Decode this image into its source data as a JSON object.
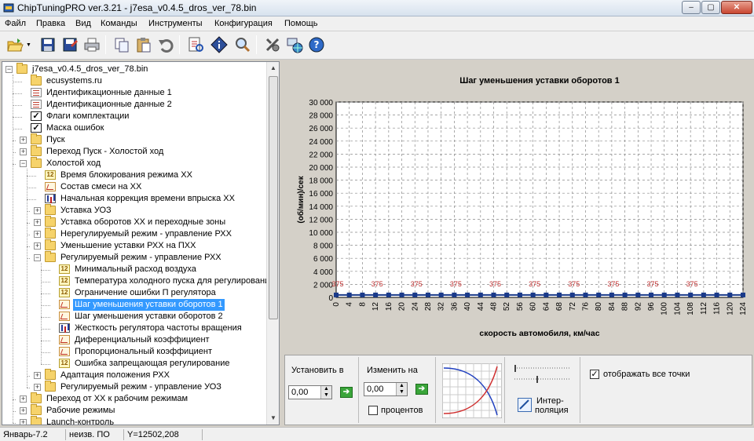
{
  "window": {
    "title": "ChipTuningPRO ver.3.21 - j7esa_v0.4.5_dros_ver_78.bin",
    "min_glyph": "–",
    "max_glyph": "▢",
    "close_glyph": "✕"
  },
  "menu": [
    "Файл",
    "Правка",
    "Вид",
    "Команды",
    "Инструменты",
    "Конфигурация",
    "Помощь"
  ],
  "toolbar_icons": [
    "open-icon",
    "save-icon",
    "save-as-icon",
    "print-icon",
    "copy-icon",
    "paste-icon",
    "undo-icon",
    "compare-icon",
    "info-icon",
    "search-icon",
    "settings-icon",
    "network-icon",
    "help-icon"
  ],
  "tree": [
    {
      "label": "j7esa_v0.4.5_dros_ver_78.bin",
      "icon": "folder-icon",
      "level": 0,
      "expander": "-"
    },
    {
      "label": "ecusystems.ru",
      "icon": "folder-icon",
      "level": 1,
      "expander": ""
    },
    {
      "label": "Идентификационные данные 1",
      "icon": "document-icon",
      "level": 1,
      "expander": ""
    },
    {
      "label": "Идентификационные данные 2",
      "icon": "document-icon",
      "level": 1,
      "expander": ""
    },
    {
      "label": "Флаги комплектации",
      "icon": "checkbox-icon",
      "level": 1,
      "expander": ""
    },
    {
      "label": "Маска ошибок",
      "icon": "checkbox-icon",
      "level": 1,
      "expander": ""
    },
    {
      "label": "Пуск",
      "icon": "folder-icon",
      "level": 1,
      "expander": "+"
    },
    {
      "label": "Переход Пуск - Холостой ход",
      "icon": "folder-icon",
      "level": 1,
      "expander": "+"
    },
    {
      "label": "Холостой ход",
      "icon": "folder-icon",
      "level": 1,
      "expander": "-"
    },
    {
      "label": "Время блокирования режима ХХ",
      "icon": "constant-icon",
      "level": 2,
      "expander": ""
    },
    {
      "label": "Состав смеси на ХХ",
      "icon": "graph-icon",
      "level": 2,
      "expander": ""
    },
    {
      "label": "Начальная коррекция времени впрыска ХХ",
      "icon": "bar-chart-icon",
      "level": 2,
      "expander": ""
    },
    {
      "label": "Уставка УОЗ",
      "icon": "folder-icon",
      "level": 2,
      "expander": "+"
    },
    {
      "label": "Уставка оборотов ХХ и переходные зоны",
      "icon": "folder-icon",
      "level": 2,
      "expander": "+"
    },
    {
      "label": "Нерегулируемый режим - управление РХХ",
      "icon": "folder-icon",
      "level": 2,
      "expander": "+"
    },
    {
      "label": "Уменьшение уставки РХХ на ПХХ",
      "icon": "folder-icon",
      "level": 2,
      "expander": "+"
    },
    {
      "label": "Регулируемый режим - управление РХХ",
      "icon": "folder-icon",
      "level": 2,
      "expander": "-"
    },
    {
      "label": "Минимальный расход воздуха",
      "icon": "constant-icon",
      "level": 3,
      "expander": ""
    },
    {
      "label": "Температура холодного пуска для регулирования",
      "icon": "constant-icon",
      "level": 3,
      "expander": ""
    },
    {
      "label": "Ограничение ошибки П регулятора",
      "icon": "constant-icon",
      "level": 3,
      "expander": ""
    },
    {
      "label": "Шаг уменьшения уставки оборотов 1",
      "icon": "graph-icon",
      "level": 3,
      "expander": "",
      "selected": true
    },
    {
      "label": "Шаг уменьшения уставки оборотов 2",
      "icon": "graph-icon",
      "level": 3,
      "expander": ""
    },
    {
      "label": "Жесткость регулятора частоты вращения",
      "icon": "bar-chart-icon",
      "level": 3,
      "expander": ""
    },
    {
      "label": "Диференциальный коэффициент",
      "icon": "graph-icon",
      "level": 3,
      "expander": ""
    },
    {
      "label": "Пропорциональный коэффициент",
      "icon": "graph-icon",
      "level": 3,
      "expander": ""
    },
    {
      "label": "Ошибка запрещающая регулирование",
      "icon": "constant-icon",
      "level": 3,
      "expander": ""
    },
    {
      "label": "Адаптация положения  РХХ",
      "icon": "folder-icon",
      "level": 2,
      "expander": "+"
    },
    {
      "label": "Регулируемый режим - управление УОЗ",
      "icon": "folder-icon",
      "level": 2,
      "expander": "+"
    },
    {
      "label": "Переход от ХХ к рабочим режимам",
      "icon": "folder-icon",
      "level": 1,
      "expander": "+"
    },
    {
      "label": "Рабочие режимы",
      "icon": "folder-icon",
      "level": 1,
      "expander": "+"
    },
    {
      "label": "Launch-контроль",
      "icon": "folder-icon",
      "level": 1,
      "expander": "+"
    }
  ],
  "chart_data": {
    "type": "line",
    "title": "Шаг уменьшения уставки оборотов 1",
    "xlabel": "скорость автомобиля, км/час",
    "ylabel": "(об/мин)/сек",
    "x": [
      0,
      4,
      8,
      12,
      16,
      20,
      24,
      28,
      32,
      36,
      40,
      44,
      48,
      52,
      56,
      60,
      64,
      68,
      72,
      76,
      80,
      84,
      88,
      92,
      96,
      100,
      104,
      108,
      112,
      116,
      120,
      124
    ],
    "series": [
      {
        "values": [
          375,
          375,
          375,
          375,
          375,
          375,
          375,
          375,
          375,
          375,
          375,
          375,
          375,
          375,
          375,
          375,
          375,
          375,
          375,
          375,
          375,
          375,
          375,
          375,
          375,
          375,
          375,
          375,
          375,
          375,
          375,
          375
        ]
      }
    ],
    "point_labels": [
      "375",
      "375",
      "375",
      "375",
      "375",
      "375",
      "375",
      "375",
      "375",
      "375"
    ],
    "y_ticks": [
      "30 000",
      "28 000",
      "26 000",
      "24 000",
      "22 000",
      "20 000",
      "18 000",
      "16 000",
      "14 000",
      "12 000",
      "10 000",
      "8 000",
      "6 000",
      "4 000",
      "2 000",
      "0"
    ],
    "x_ticks": [
      "0",
      "4",
      "8",
      "12",
      "16",
      "20",
      "24",
      "28",
      "32",
      "36",
      "40",
      "44",
      "48",
      "52",
      "56",
      "60",
      "64",
      "68",
      "72",
      "76",
      "80",
      "84",
      "88",
      "92",
      "96",
      "100",
      "104",
      "108",
      "112",
      "116",
      "120",
      "124"
    ],
    "xlim": [
      0,
      124
    ],
    "ylim": [
      0,
      30000
    ],
    "grid": true,
    "line_color": "#1a3a8a",
    "label_color": "#c03030"
  },
  "controls": {
    "set_label": "Установить в",
    "set_value": "0,00",
    "change_label": "Изменить на",
    "change_value": "0,00",
    "percent_label": "процентов",
    "percent_checked": false,
    "interp_label_1": "Интер-",
    "interp_label_2": "поляция",
    "show_all_label": "отображать все точки",
    "show_all_checked": true,
    "check_glyph": "✓",
    "go_glyph": "➔"
  },
  "status": {
    "cell1": "Январь-7.2",
    "cell2": "неизв. ПО",
    "cell3": "Y=12502,208"
  }
}
